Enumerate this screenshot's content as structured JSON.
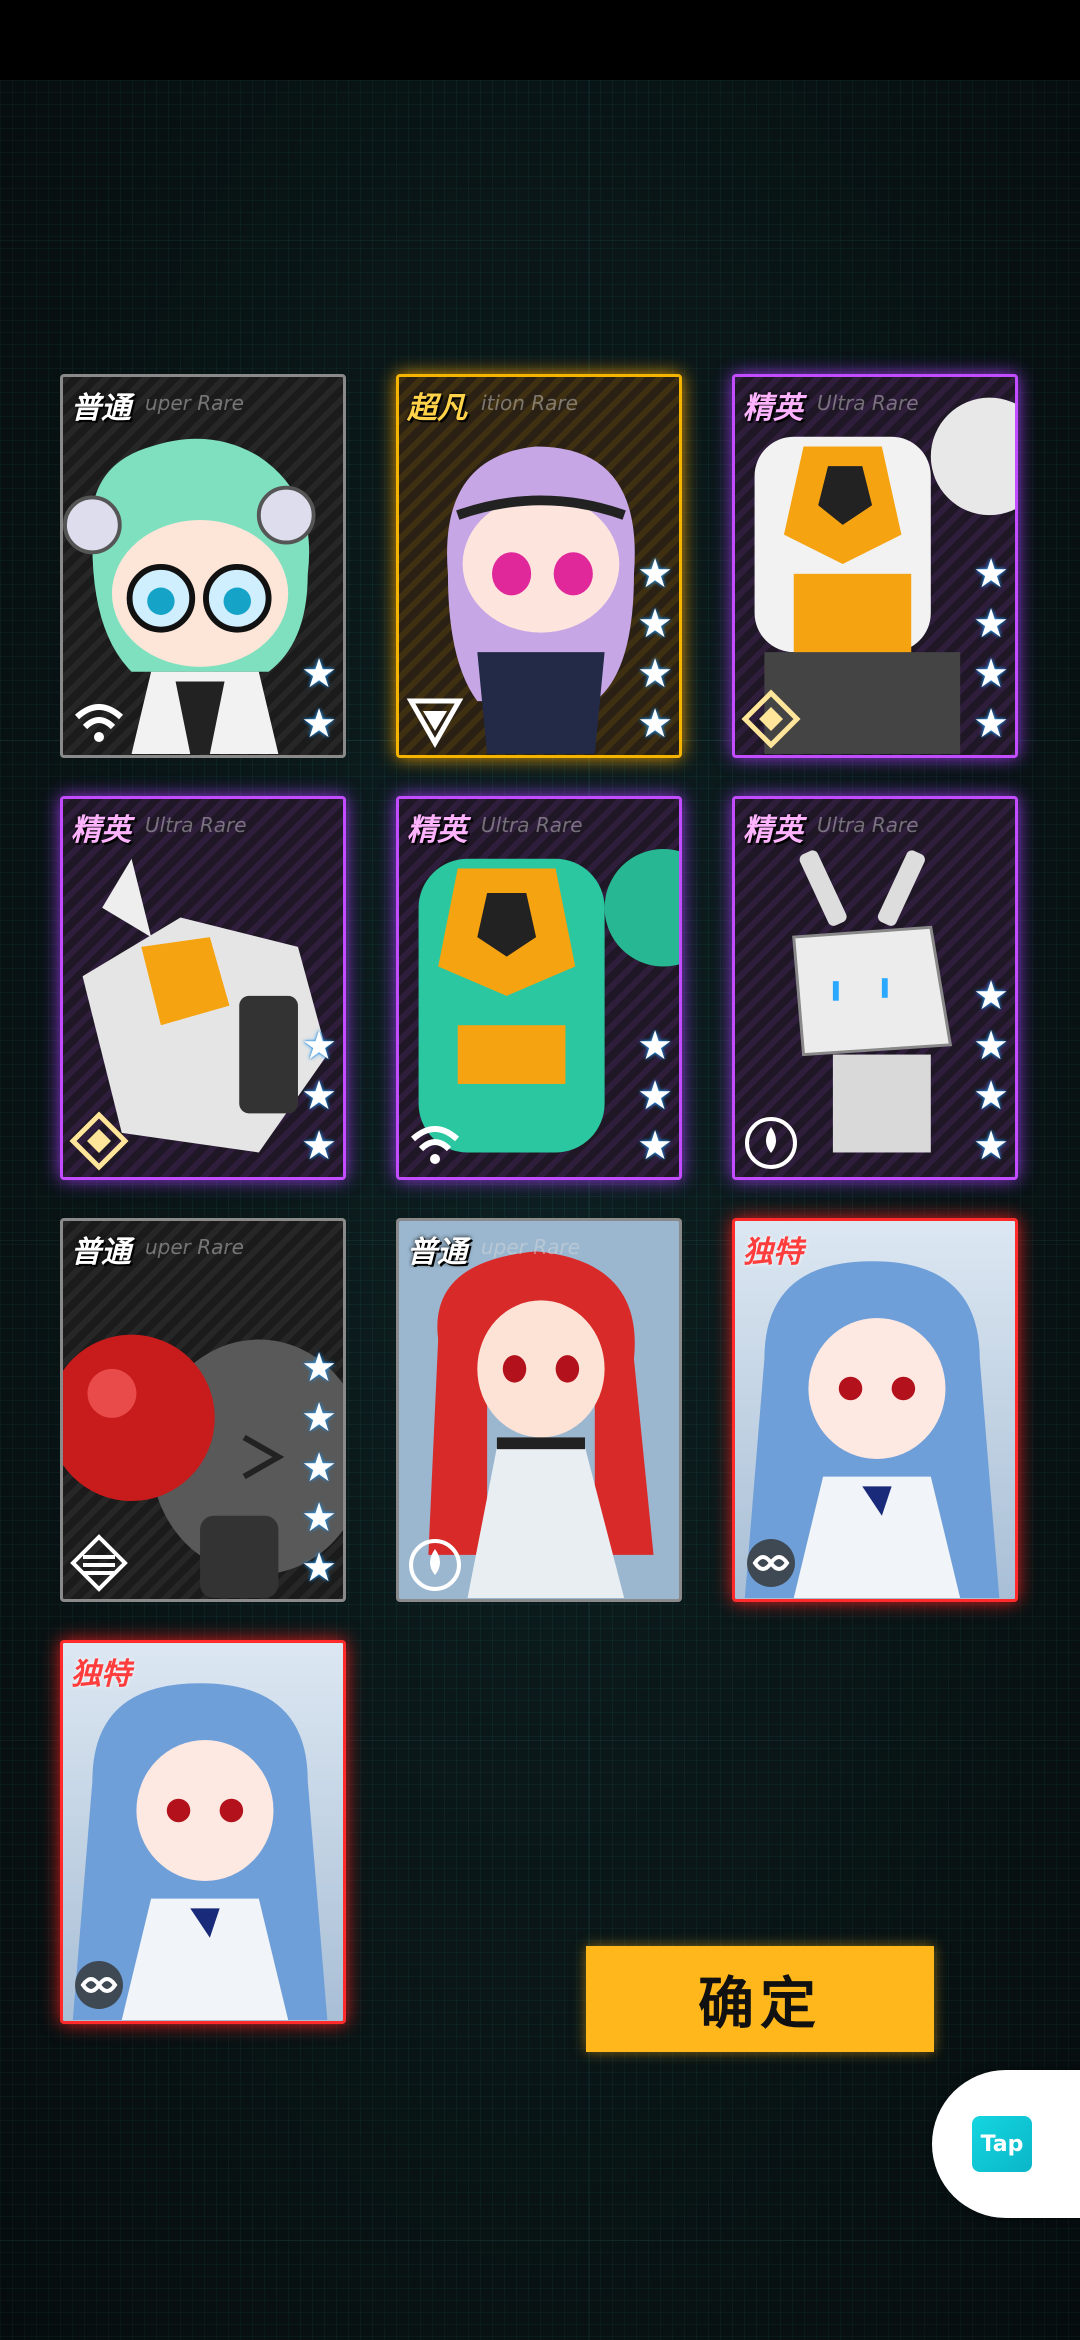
{
  "cards": [
    {
      "rarity": "普通",
      "rarity_en": "uper Rare",
      "stars": 2,
      "faction": "wifi-faction-icon",
      "theme": "common"
    },
    {
      "rarity": "超凡",
      "rarity_en": "ition Rare",
      "stars": 4,
      "faction": "triangle-faction-icon",
      "theme": "gold"
    },
    {
      "rarity": "精英",
      "rarity_en": "Ultra Rare",
      "stars": 4,
      "faction": "diamond-faction-icon",
      "theme": "purple"
    },
    {
      "rarity": "精英",
      "rarity_en": "Ultra Rare",
      "stars": 3,
      "faction": "diamond-faction-icon",
      "theme": "purple"
    },
    {
      "rarity": "精英",
      "rarity_en": "Ultra Rare",
      "stars": 3,
      "faction": "wifi-faction-icon",
      "theme": "purple"
    },
    {
      "rarity": "精英",
      "rarity_en": "Ultra Rare",
      "stars": 4,
      "faction": "drop-faction-icon",
      "theme": "purple"
    },
    {
      "rarity": "普通",
      "rarity_en": "uper Rare",
      "stars": 5,
      "faction": "stripes-faction-icon",
      "theme": "common"
    },
    {
      "rarity": "普通",
      "rarity_en": "uper Rare",
      "stars": 0,
      "faction": "drop-faction-icon",
      "theme": "common"
    },
    {
      "rarity": "独特",
      "rarity_en": "",
      "stars": 0,
      "faction": "infinity-faction-icon",
      "theme": "red"
    },
    {
      "rarity": "独特",
      "rarity_en": "",
      "stars": 0,
      "faction": "infinity-faction-icon",
      "theme": "red"
    }
  ],
  "confirm_label": "确定",
  "tap_label": "Tap"
}
